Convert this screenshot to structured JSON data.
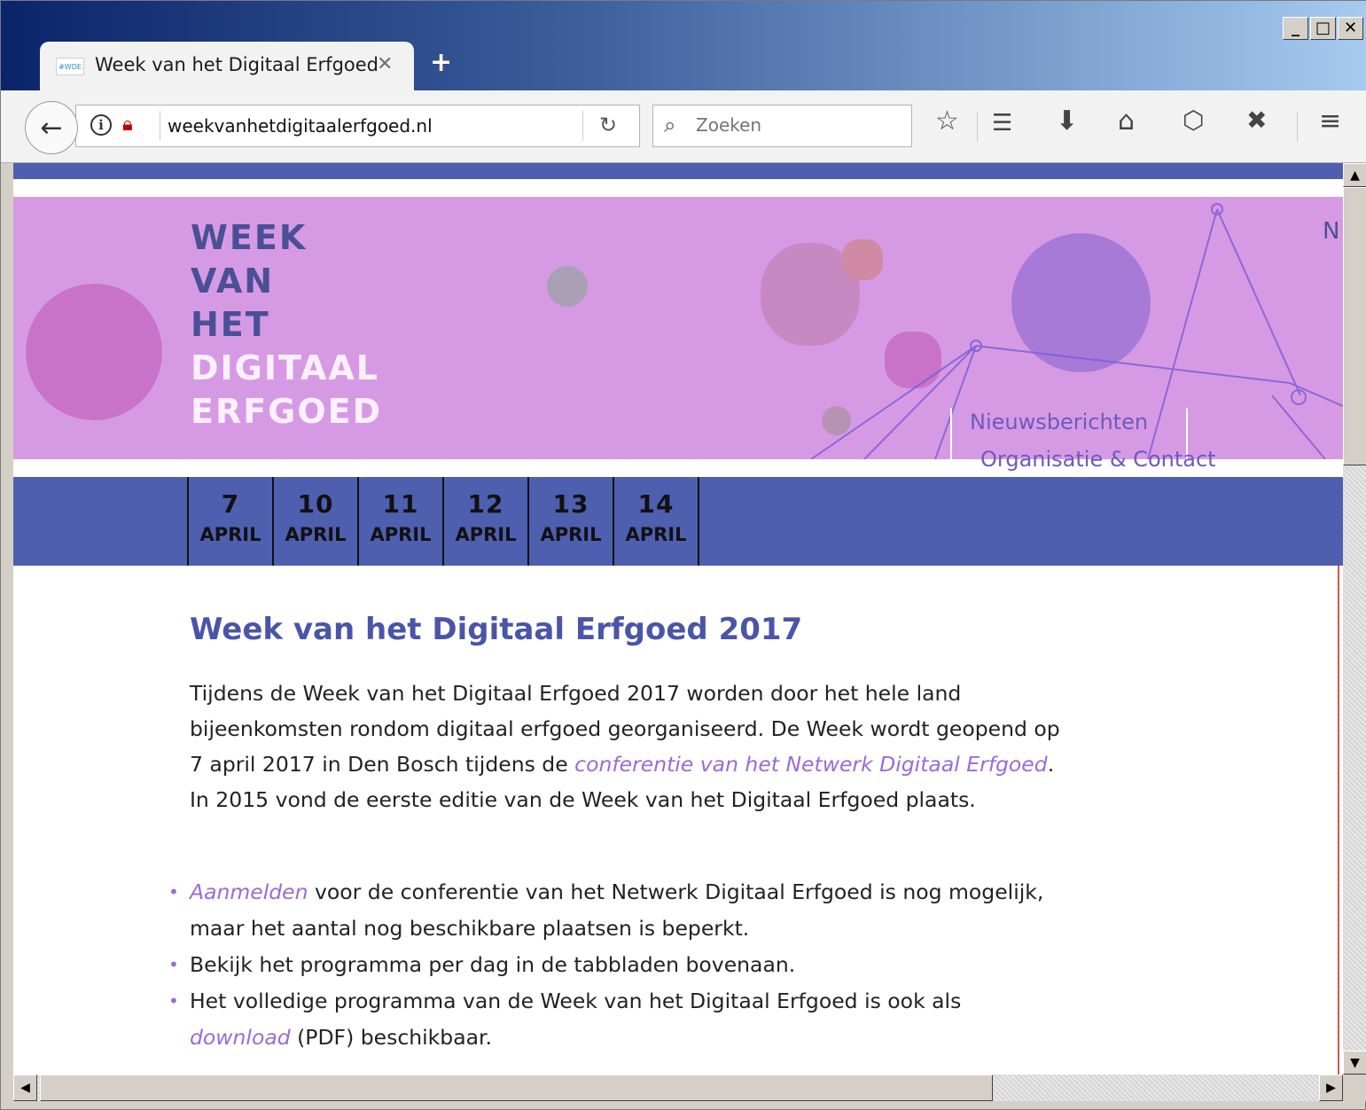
{
  "browser": {
    "tab": {
      "favicon_text": "#WDE",
      "title": "Week van het Digitaal Erfgoed",
      "close": "✕"
    },
    "new_tab": "+",
    "url": "weekvanhetdigitaalerfgoed.nl",
    "search_placeholder": "Zoeken",
    "window_buttons": {
      "minimize": "_",
      "maximize": "□",
      "close": "✕"
    },
    "toolbar_icons": [
      "star-icon",
      "reading-list-icon",
      "download-icon",
      "home-icon",
      "pocket-icon",
      "extension-icon",
      "menu-icon"
    ]
  },
  "banner": {
    "logo_lines": [
      "WEEK",
      "VAN",
      "HET",
      "DIGITAAL",
      "ERFGOED"
    ],
    "edge_letter": "N",
    "nav": [
      "Nieuwsberichten",
      "Organisatie & Contact"
    ]
  },
  "dates": [
    {
      "day": "7",
      "month": "APRIL"
    },
    {
      "day": "10",
      "month": "APRIL"
    },
    {
      "day": "11",
      "month": "APRIL"
    },
    {
      "day": "12",
      "month": "APRIL"
    },
    {
      "day": "13",
      "month": "APRIL"
    },
    {
      "day": "14",
      "month": "APRIL"
    }
  ],
  "content": {
    "heading": "Week van het Digitaal Erfgoed 2017",
    "para_1": "Tijdens de Week van het Digitaal Erfgoed 2017 worden door het hele land bijeenkomsten rondom digitaal erfgoed georganiseerd. De Week wordt geopend op 7 april 2017 in Den Bosch tijdens de ",
    "para_link": "conferentie van het Netwerk Digitaal Erfgoed",
    "para_2": ". In 2015 vond de eerste editie van de Week van het Digitaal Erfgoed plaats.",
    "bullet_1_link": "Aanmelden",
    "bullet_1_text": " voor de conferentie van het Netwerk Digitaal Erfgoed is nog mogelijk, maar het aantal nog beschikbare plaatsen is beperkt.",
    "bullet_2_text": "Bekijk het programma per dag in de tabbladen bovenaan.",
    "bullet_3_text": "Het volledige programma van de Week van het Digitaal Erfgoed is ook als ",
    "bullet_3_link": "download",
    "bullet_3_end": " (PDF) beschikbaar."
  },
  "colors": {
    "accent": "#4e5fb0",
    "banner": "#d69ae4",
    "link": "#9c6ad6",
    "heading": "#4a55a8"
  }
}
